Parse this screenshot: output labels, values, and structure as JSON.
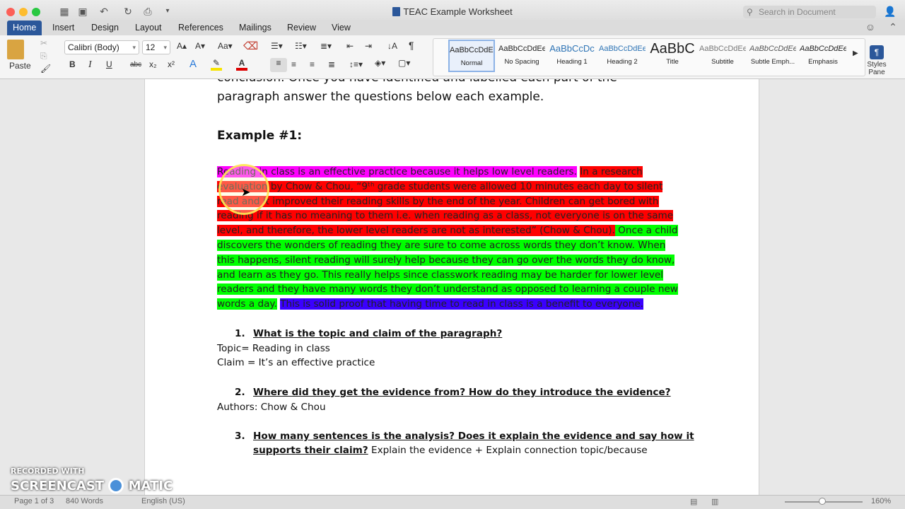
{
  "window": {
    "title": "TEAC Example Worksheet",
    "search_placeholder": "Search in Document"
  },
  "tabs": [
    "Home",
    "Insert",
    "Design",
    "Layout",
    "References",
    "Mailings",
    "Review",
    "View"
  ],
  "ribbon": {
    "paste_label": "Paste",
    "font_name": "Calibri (Body)",
    "font_size": "12",
    "styles": [
      {
        "preview": "AaBbCcDdEe",
        "label": "Normal"
      },
      {
        "preview": "AaBbCcDdEe",
        "label": "No Spacing"
      },
      {
        "preview": "AaBbCcDc",
        "label": "Heading 1"
      },
      {
        "preview": "AaBbCcDdEe",
        "label": "Heading 2"
      },
      {
        "preview": "AaBbC",
        "label": "Title"
      },
      {
        "preview": "AaBbCcDdEe",
        "label": "Subtitle"
      },
      {
        "preview": "AaBbCcDdEe",
        "label": "Subtle Emph..."
      },
      {
        "preview": "AaBbCcDdEe",
        "label": "Emphasis"
      }
    ],
    "styles_pane_label": "Styles Pane"
  },
  "document": {
    "intro_line1": "conclusion. Once you have identified and labelled each part of the",
    "intro_line2": "paragraph answer the questions below each example.",
    "example_heading": "Example #1:",
    "paragraph_lines": [
      [
        {
          "t": "Reading in class is an effective practice because it helps low level readers.",
          "c": "m"
        },
        {
          "t": " ",
          "c": ""
        },
        {
          "t": "In a research",
          "c": "r"
        }
      ],
      [
        {
          "t": "evaluation by Chow & Chou, “9ᵗʰ grade students were allowed 10 minutes each day to silent",
          "c": "r"
        }
      ],
      [
        {
          "t": "read and it improved their reading skills by the end of the year. Children can get bored with",
          "c": "r"
        }
      ],
      [
        {
          "t": "reading if it has no meaning to them i.e. when reading as a class, not everyone is on the same",
          "c": "r"
        }
      ],
      [
        {
          "t": "level, and therefore, the lower level readers are not as interested” (Chow & Chou).",
          "c": "r"
        },
        {
          "t": " Once a child",
          "c": "g"
        }
      ],
      [
        {
          "t": "discovers the wonders of reading they are sure to come across words they don’t know. When",
          "c": "g"
        }
      ],
      [
        {
          "t": "this happens, silent reading will surely help because they can go over the words they do know,",
          "c": "g"
        }
      ],
      [
        {
          "t": "and learn as they go. This really helps since classwork reading may be harder for lower level",
          "c": "g"
        }
      ],
      [
        {
          "t": "readers and they have many words they don’t understand as opposed to learning a couple new",
          "c": "g"
        }
      ],
      [
        {
          "t": "words a day.",
          "c": "g"
        },
        {
          "t": " ",
          "c": ""
        },
        {
          "t": "This is solid proof that having time to read in class is a benefit to everyone.",
          "c": "b"
        }
      ]
    ],
    "q1_num": "1.",
    "q1": "What is the topic and claim of the paragraph?",
    "a1_topic": "Topic= Reading in class",
    "a1_claim": "Claim = It’s an effective practice",
    "q2_num": "2.",
    "q2": "Where did they get the evidence from? How do they introduce the evidence?",
    "a2": "Authors: Chow & Chou",
    "q3_num": "3.",
    "q3_line1": "How many sentences is the analysis?  Does it explain the evidence and say how it",
    "q3_line2": "supports their claim?",
    "a3": " Explain the evidence + Explain connection topic/because"
  },
  "status": {
    "page": "Page 1 of 3",
    "words": "840 Words",
    "language": "English (US)",
    "zoom": "160%"
  },
  "watermark": {
    "line1": "RECORDED WITH",
    "brand_left": "SCREENCAST",
    "brand_right": "MATIC"
  },
  "colors": {
    "magenta": "#ff00ff",
    "red": "#ff0000",
    "green": "#00ff00",
    "blue": "#3a00ff",
    "accent": "#2b579a"
  }
}
